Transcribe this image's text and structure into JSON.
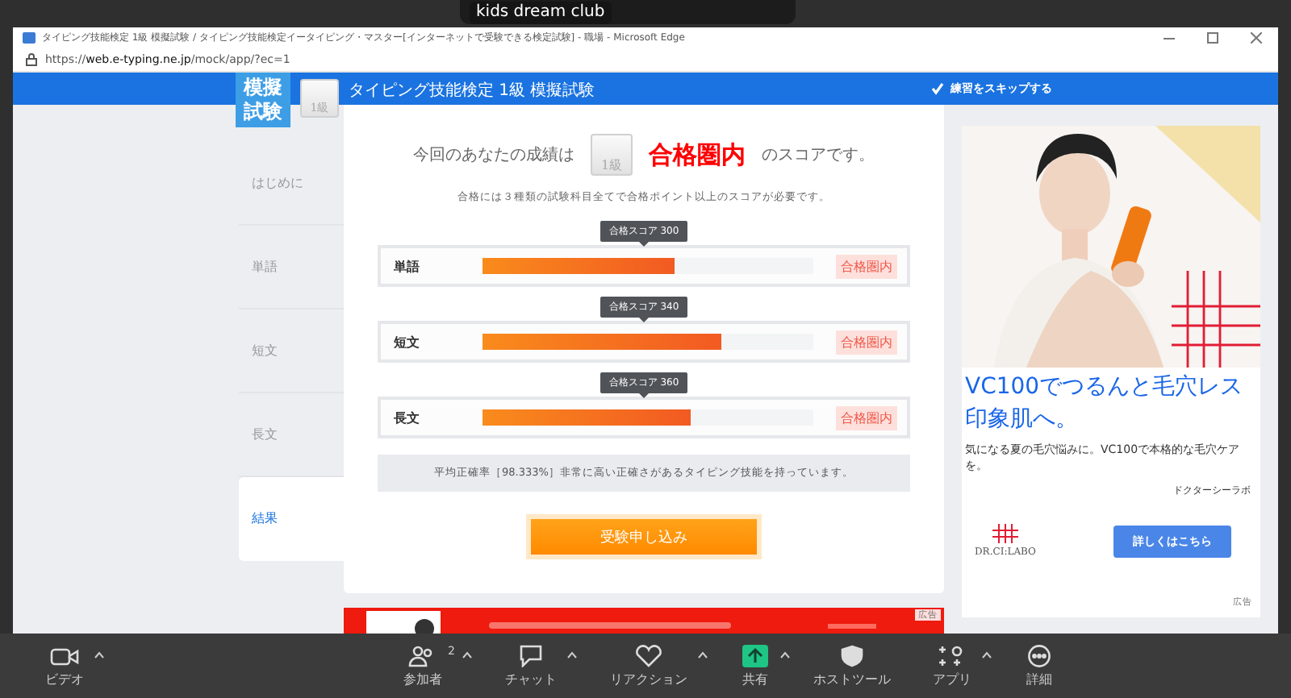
{
  "meeting": {
    "video_label": "kids dream club"
  },
  "browser": {
    "title": "タイピング技能検定 1級 模擬試験 / タイピング技能検定イータイピング・マスター[インターネットで受験できる検定試験] - 職場 - Microsoft Edge",
    "url_prefix": "https://",
    "url_domain": "web.e-typing.ne.jp",
    "url_path": "/mock/app/?ec=1"
  },
  "header": {
    "logo": "模擬試験",
    "grade": "1級",
    "title": "タイピング技能検定 1級 模擬試験",
    "skip": {
      "label": "練習をスキップする",
      "checked": true
    }
  },
  "sidebar": {
    "items": [
      {
        "label": "はじめに",
        "selected": false
      },
      {
        "label": "単語",
        "selected": false
      },
      {
        "label": "短文",
        "selected": false
      },
      {
        "label": "長文",
        "selected": false
      },
      {
        "label": "結果",
        "selected": true
      }
    ]
  },
  "result": {
    "lead": "今回のあなたの成績は",
    "grade": "1級",
    "verdict": "合格圏内",
    "tail": "のスコアです。",
    "note": "合格には３種類の試験科目全てで合格ポイント以上のスコアが必要です。",
    "scores": [
      {
        "subject": "単語",
        "target": "合格スコア 300",
        "level": 0.58,
        "status": "合格圏内"
      },
      {
        "subject": "短文",
        "target": "合格スコア 340",
        "level": 0.72,
        "status": "合格圏内"
      },
      {
        "subject": "長文",
        "target": "合格スコア 360",
        "level": 0.63,
        "status": "合格圏内"
      }
    ],
    "summary": "平均正確率［98.333%］非常に高い正確さがあるタイピング技能を持っています。",
    "apply": "受験申し込み"
  },
  "ad": {
    "headline": "VC100でつるんと毛穴レス印象肌へ。",
    "body": "気になる夏の毛穴悩みに。VC100で本格的な毛穴ケアを。",
    "advertiser": "ドクターシーラボ",
    "logo": "DR.CI:LABO",
    "cta": "詳しくはこちら",
    "ad_label": "広告"
  },
  "banner_ad": {
    "ad_label": "広告"
  },
  "toolbar": [
    {
      "label": "ビデオ",
      "kind": "video",
      "caret": true
    },
    {
      "label": "参加者",
      "kind": "people",
      "badge": "2",
      "caret": true
    },
    {
      "label": "チャット",
      "kind": "chat",
      "caret": true
    },
    {
      "label": "リアクション",
      "kind": "heart",
      "caret": true
    },
    {
      "label": "共有",
      "kind": "share",
      "caret": true
    },
    {
      "label": "ホストツール",
      "kind": "shield",
      "caret": false
    },
    {
      "label": "アプリ",
      "kind": "apps",
      "caret": true
    },
    {
      "label": "詳細",
      "kind": "more",
      "caret": false
    }
  ]
}
